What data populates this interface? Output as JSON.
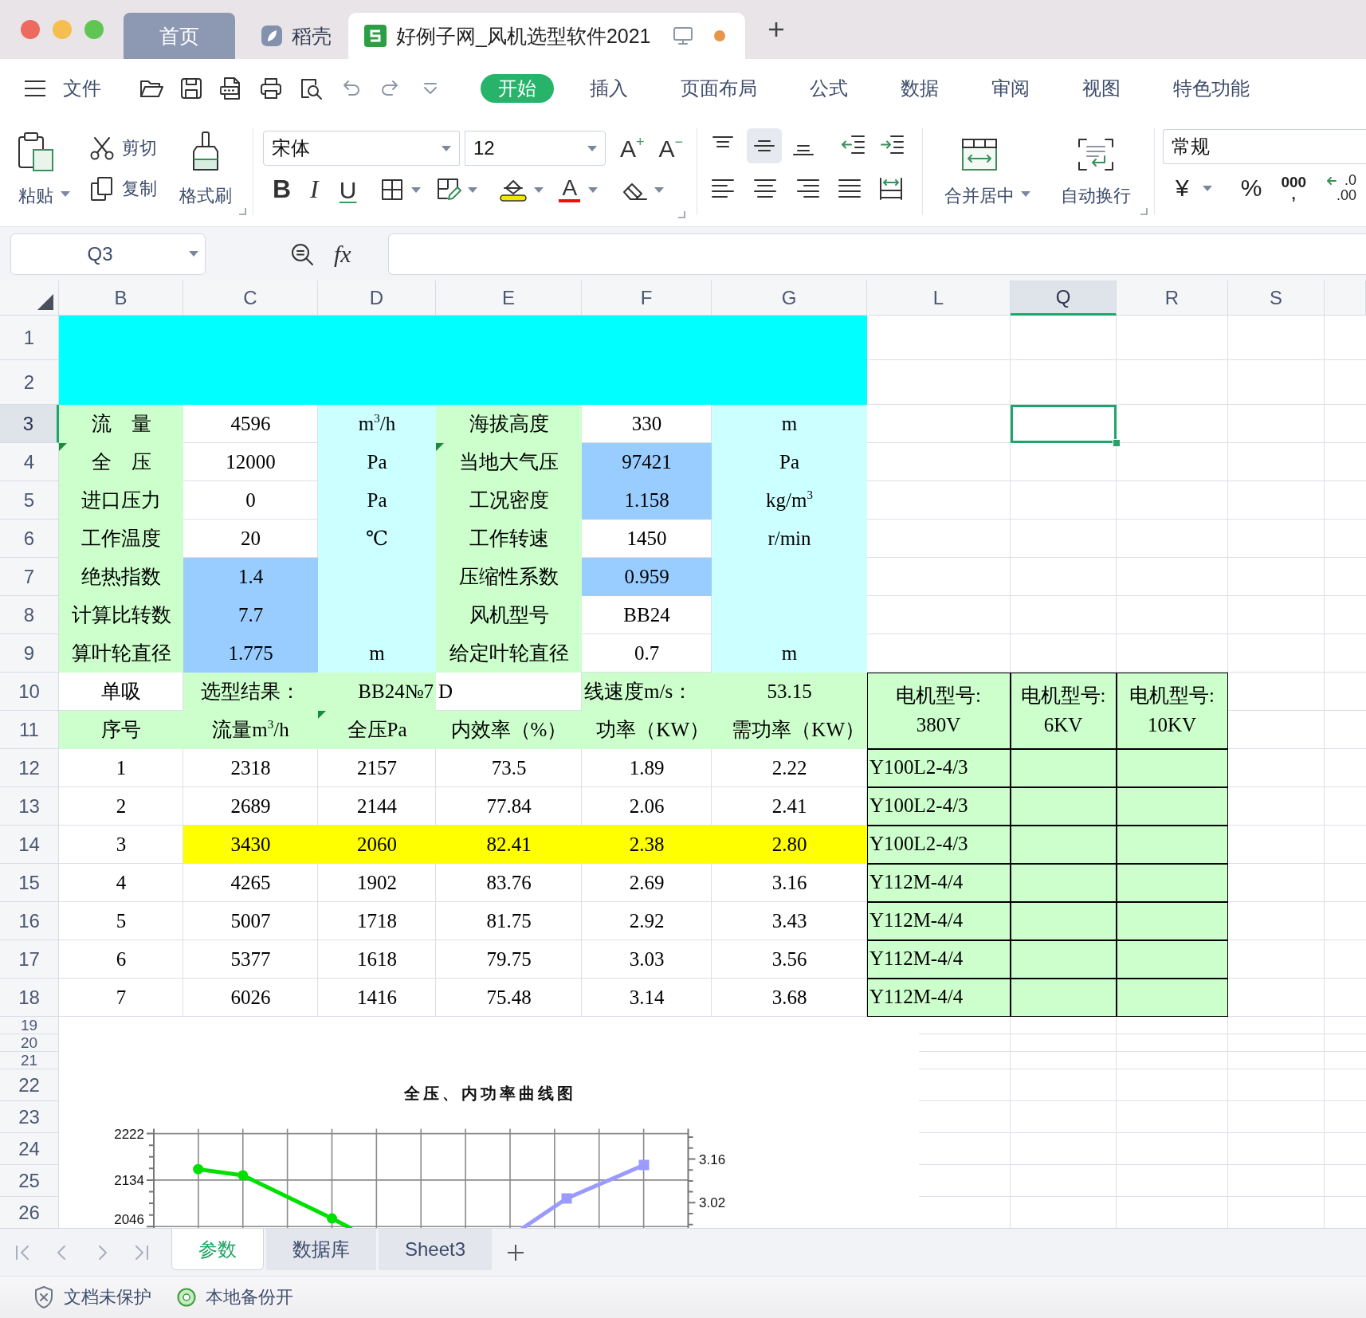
{
  "window": {
    "tabs": [
      {
        "kind": "home",
        "label": "首页",
        "selected": false,
        "unsaved": false
      },
      {
        "kind": "app",
        "label": "稻壳",
        "selected": false,
        "unsaved": false
      },
      {
        "kind": "document",
        "label": "好例子网_风机选型软件2021",
        "selected": true,
        "unsaved": true
      }
    ]
  },
  "menu": {
    "file": "文件",
    "tabs": [
      {
        "label": "开始",
        "selected": true
      },
      {
        "label": "插入",
        "selected": false
      },
      {
        "label": "页面布局",
        "selected": false
      },
      {
        "label": "公式",
        "selected": false
      },
      {
        "label": "数据",
        "selected": false
      },
      {
        "label": "审阅",
        "selected": false
      },
      {
        "label": "视图",
        "selected": false
      },
      {
        "label": "特色功能",
        "selected": false
      }
    ]
  },
  "ribbon": {
    "paste": "粘贴",
    "cut": "剪切",
    "copy": "复制",
    "format_painter": "格式刷",
    "font_name": "宋体",
    "font_size": "12",
    "grow_font": "A$^{+}$",
    "shrink_font": "A$^{−}$",
    "bold": "B",
    "italic": "I",
    "underline": "U",
    "font_color": "A",
    "vertical_align": [
      {
        "selected": false
      },
      {
        "selected": true
      },
      {
        "selected": false
      }
    ],
    "horizontal_align": [
      {
        "selected": false
      },
      {
        "selected": false
      },
      {
        "selected": false
      },
      {
        "selected": false
      },
      {
        "selected": false
      }
    ],
    "merge": "合并居中",
    "wrap_text": "自动换行",
    "number_format": "常规",
    "currency": "¥",
    "percent": "%",
    "thousands": "000\n,",
    "decimal_increase": ".0\n.00"
  },
  "formula_bar": {
    "name_box": "Q3",
    "function_label": "fx"
  },
  "sheet": {
    "columns": [
      {
        "label": "B",
        "selected": false
      },
      {
        "label": "C",
        "selected": false
      },
      {
        "label": "D",
        "selected": false
      },
      {
        "label": "E",
        "selected": false
      },
      {
        "label": "F",
        "selected": false
      },
      {
        "label": "G",
        "selected": false
      },
      {
        "label": "L",
        "selected": false
      },
      {
        "label": "Q",
        "selected": true
      },
      {
        "label": "R",
        "selected": false
      },
      {
        "label": "S",
        "selected": false
      }
    ],
    "rows": [
      {
        "label": "1",
        "selected": false,
        "cells": [
          {
            "kind": "fill",
            "color": "#00ffff",
            "flagged": false,
            "bordered": false
          },
          {
            "kind": "mergeleft"
          },
          {
            "kind": "mergeleft"
          },
          {
            "kind": "mergeleft"
          },
          {
            "kind": "mergeleft"
          },
          {
            "kind": "mergeleft"
          }
        ]
      },
      {
        "label": "2",
        "selected": false,
        "cells": [
          {
            "kind": "mergeup"
          },
          {
            "kind": "mergeup"
          },
          {
            "kind": "mergeup"
          },
          {
            "kind": "mergeup"
          },
          {
            "kind": "mergeup"
          },
          {
            "kind": "mergeup"
          }
        ]
      },
      {
        "label": "3",
        "selected": true,
        "cells": [
          {
            "kind": "text",
            "text": "流　量",
            "color": "#ccffcc",
            "flagged": false,
            "bordered": false
          },
          {
            "kind": "text",
            "text": "4596",
            "flagged": false,
            "bordered": false
          },
          {
            "kind": "text",
            "text": "m$^{3}$/h",
            "color": "#ccffff",
            "flagged": false,
            "bordered": false
          },
          {
            "kind": "text",
            "text": "海拔高度",
            "color": "#ccffcc",
            "flagged": false,
            "bordered": false
          },
          {
            "kind": "text",
            "text": "330",
            "flagged": false,
            "bordered": false
          },
          {
            "kind": "text",
            "text": "m",
            "color": "#ccffff",
            "flagged": false,
            "bordered": false
          }
        ]
      },
      {
        "label": "4",
        "selected": false,
        "cells": [
          {
            "kind": "text",
            "text": "全　压",
            "color": "#ccffcc",
            "flagged": true,
            "bordered": false
          },
          {
            "kind": "text",
            "text": "12000",
            "flagged": false,
            "bordered": false
          },
          {
            "kind": "text",
            "text": "Pa",
            "color": "#ccffff",
            "flagged": false,
            "bordered": false
          },
          {
            "kind": "text",
            "text": "当地大气压",
            "color": "#ccffcc",
            "flagged": true,
            "bordered": false
          },
          {
            "kind": "text",
            "text": "97421",
            "color": "#99ccff",
            "flagged": false,
            "bordered": false
          },
          {
            "kind": "text",
            "text": "Pa",
            "color": "#ccffff",
            "flagged": false,
            "bordered": false
          }
        ]
      },
      {
        "label": "5",
        "selected": false,
        "cells": [
          {
            "kind": "text",
            "text": "进口压力",
            "color": "#ccffcc",
            "flagged": false,
            "bordered": false
          },
          {
            "kind": "text",
            "text": "0",
            "flagged": false,
            "bordered": false
          },
          {
            "kind": "text",
            "text": "Pa",
            "color": "#ccffff",
            "flagged": false,
            "bordered": false
          },
          {
            "kind": "text",
            "text": "工况密度",
            "color": "#ccffcc",
            "flagged": false,
            "bordered": false
          },
          {
            "kind": "text",
            "text": "1.158",
            "color": "#99ccff",
            "flagged": false,
            "bordered": false
          },
          {
            "kind": "text",
            "text": "kg/m$^{3}$",
            "color": "#ccffff",
            "flagged": false,
            "bordered": false
          }
        ]
      },
      {
        "label": "6",
        "selected": false,
        "cells": [
          {
            "kind": "text",
            "text": "工作温度",
            "color": "#ccffcc",
            "flagged": false,
            "bordered": false
          },
          {
            "kind": "text",
            "text": "20",
            "flagged": false,
            "bordered": false
          },
          {
            "kind": "text",
            "text": "℃",
            "color": "#ccffff",
            "flagged": false,
            "bordered": false
          },
          {
            "kind": "text",
            "text": "工作转速",
            "color": "#ccffcc",
            "flagged": false,
            "bordered": false
          },
          {
            "kind": "text",
            "text": "1450",
            "flagged": false,
            "bordered": false
          },
          {
            "kind": "text",
            "text": "r/min",
            "color": "#ccffff",
            "flagged": false,
            "bordered": false
          }
        ]
      },
      {
        "label": "7",
        "selected": false,
        "cells": [
          {
            "kind": "text",
            "text": "绝热指数",
            "color": "#ccffcc",
            "flagged": false,
            "bordered": false
          },
          {
            "kind": "text",
            "text": "1.4",
            "color": "#99ccff",
            "flagged": false,
            "bordered": false
          },
          {
            "kind": "fill",
            "color": "#ccffff",
            "flagged": false,
            "bordered": false
          },
          {
            "kind": "text",
            "text": "压缩性系数",
            "color": "#ccffcc",
            "flagged": false,
            "bordered": false
          },
          {
            "kind": "text",
            "text": "0.959",
            "color": "#99ccff",
            "flagged": false,
            "bordered": false
          },
          {
            "kind": "fill",
            "color": "#ccffff",
            "flagged": false,
            "bordered": false
          }
        ]
      },
      {
        "label": "8",
        "selected": false,
        "cells": [
          {
            "kind": "text",
            "text": "计算比转数",
            "color": "#ccffcc",
            "flagged": false,
            "bordered": false
          },
          {
            "kind": "text",
            "text": "7.7",
            "color": "#99ccff",
            "flagged": false,
            "bordered": false
          },
          {
            "kind": "fill",
            "color": "#ccffff",
            "flagged": false,
            "bordered": false
          },
          {
            "kind": "text",
            "text": "风机型号",
            "color": "#ccffcc",
            "flagged": false,
            "bordered": false
          },
          {
            "kind": "text",
            "text": "BB24",
            "flagged": false,
            "bordered": false
          },
          {
            "kind": "fill",
            "color": "#ccffff",
            "flagged": false,
            "bordered": false
          }
        ]
      },
      {
        "label": "9",
        "selected": false,
        "cells": [
          {
            "kind": "text",
            "text": "算叶轮直径",
            "color": "#ccffcc",
            "flagged": false,
            "bordered": false
          },
          {
            "kind": "text",
            "text": "1.775",
            "color": "#99ccff",
            "flagged": false,
            "bordered": false
          },
          {
            "kind": "text",
            "text": "m",
            "color": "#ccffff",
            "flagged": false,
            "bordered": false
          },
          {
            "kind": "text",
            "text": "给定叶轮直径",
            "color": "#ccffcc",
            "flagged": false,
            "bordered": false
          },
          {
            "kind": "text",
            "text": "0.7",
            "flagged": false,
            "bordered": false
          },
          {
            "kind": "text",
            "text": "m",
            "color": "#ccffff",
            "flagged": false,
            "bordered": false
          }
        ]
      },
      {
        "label": "10",
        "selected": false,
        "cells": [
          {
            "kind": "text",
            "text": "单吸",
            "flagged": false,
            "bordered": false
          },
          {
            "kind": "text",
            "text": "选型结果：",
            "color": "#ccffcc",
            "flagged": false,
            "bordered": false
          },
          {
            "kind": "textright",
            "text": "BB24№7",
            "color": "#ccffcc",
            "flagged": false,
            "bordered": false
          },
          {
            "kind": "textleft",
            "text": "D",
            "flagged": false,
            "bordered": false
          },
          {
            "kind": "textleft",
            "text": "线速度m/s：",
            "color": "#ccffcc",
            "flagged": false,
            "bordered": false
          },
          {
            "kind": "text",
            "text": "53.15",
            "color": "#ccffcc",
            "flagged": false,
            "bordered": false
          },
          {
            "kind": "text",
            "text": "电机型号:\n380V",
            "color": "#ccffcc",
            "flagged": false,
            "bordered": true
          },
          {
            "kind": "text",
            "text": "电机型号:\n6KV",
            "color": "#ccffcc",
            "flagged": false,
            "bordered": true
          },
          {
            "kind": "text",
            "text": "电机型号:\n10KV",
            "color": "#ccffcc",
            "flagged": false,
            "bordered": true
          }
        ]
      },
      {
        "label": "11",
        "selected": false,
        "cells": [
          {
            "kind": "text",
            "text": "序号",
            "color": "#ccffcc",
            "flagged": false,
            "bordered": false
          },
          {
            "kind": "text",
            "text": "流量m$^{3}$/h",
            "color": "#ccffcc",
            "flagged": false,
            "bordered": false
          },
          {
            "kind": "text",
            "text": "全压Pa",
            "color": "#ccffcc",
            "flagged": true,
            "bordered": false
          },
          {
            "kind": "text",
            "text": "内效率（%）",
            "color": "#ccffcc",
            "flagged": false,
            "bordered": false
          },
          {
            "kind": "textright",
            "text": "功率（KW）",
            "color": "#ccffcc",
            "flagged": false,
            "bordered": false
          },
          {
            "kind": "textright",
            "text": "需功率（KW）",
            "color": "#ccffcc",
            "flagged": false,
            "bordered": false
          },
          {
            "kind": "mergeup"
          },
          {
            "kind": "mergeup"
          },
          {
            "kind": "mergeup"
          }
        ]
      },
      {
        "label": "12",
        "selected": false,
        "cells": [
          {
            "kind": "text",
            "text": "1",
            "flagged": false,
            "bordered": false
          },
          {
            "kind": "text",
            "text": "2318",
            "flagged": false,
            "bordered": false
          },
          {
            "kind": "text",
            "text": "2157",
            "flagged": false,
            "bordered": false
          },
          {
            "kind": "text",
            "text": "73.5",
            "flagged": false,
            "bordered": false
          },
          {
            "kind": "text",
            "text": "1.89",
            "flagged": false,
            "bordered": false
          },
          {
            "kind": "text",
            "text": "2.22",
            "flagged": false,
            "bordered": false
          },
          {
            "kind": "textleft",
            "text": "Y100L2-4/3",
            "color": "#ccffcc",
            "flagged": false,
            "bordered": true
          },
          {
            "kind": "fill",
            "color": "#ccffcc",
            "flagged": false,
            "bordered": true
          },
          {
            "kind": "fill",
            "color": "#ccffcc",
            "flagged": false,
            "bordered": true
          }
        ]
      },
      {
        "label": "13",
        "selected": false,
        "cells": [
          {
            "kind": "text",
            "text": "2",
            "flagged": false,
            "bordered": false
          },
          {
            "kind": "text",
            "text": "2689",
            "flagged": false,
            "bordered": false
          },
          {
            "kind": "text",
            "text": "2144",
            "flagged": false,
            "bordered": false
          },
          {
            "kind": "text",
            "text": "77.84",
            "flagged": false,
            "bordered": false
          },
          {
            "kind": "text",
            "text": "2.06",
            "flagged": false,
            "bordered": false
          },
          {
            "kind": "text",
            "text": "2.41",
            "flagged": false,
            "bordered": false
          },
          {
            "kind": "textleft",
            "text": "Y100L2-4/3",
            "color": "#ccffcc",
            "flagged": false,
            "bordered": true
          },
          {
            "kind": "fill",
            "color": "#ccffcc",
            "flagged": false,
            "bordered": true
          },
          {
            "kind": "fill",
            "color": "#ccffcc",
            "flagged": false,
            "bordered": true
          }
        ]
      },
      {
        "label": "14",
        "selected": false,
        "cells": [
          {
            "kind": "text",
            "text": "3",
            "flagged": false,
            "bordered": false
          },
          {
            "kind": "text",
            "text": "3430",
            "color": "#ffff00",
            "flagged": false,
            "bordered": false
          },
          {
            "kind": "text",
            "text": "2060",
            "color": "#ffff00",
            "flagged": false,
            "bordered": false
          },
          {
            "kind": "text",
            "text": "82.41",
            "color": "#ffff00",
            "flagged": false,
            "bordered": false
          },
          {
            "kind": "text",
            "text": "2.38",
            "color": "#ffff00",
            "flagged": false,
            "bordered": false
          },
          {
            "kind": "text",
            "text": "2.80",
            "color": "#ffff00",
            "flagged": false,
            "bordered": false
          },
          {
            "kind": "textleft",
            "text": "Y100L2-4/3",
            "color": "#ccffcc",
            "flagged": false,
            "bordered": true
          },
          {
            "kind": "fill",
            "color": "#ccffcc",
            "flagged": false,
            "bordered": true
          },
          {
            "kind": "fill",
            "color": "#ccffcc",
            "flagged": false,
            "bordered": true
          }
        ]
      },
      {
        "label": "15",
        "selected": false,
        "cells": [
          {
            "kind": "text",
            "text": "4",
            "flagged": false,
            "bordered": false
          },
          {
            "kind": "text",
            "text": "4265",
            "flagged": false,
            "bordered": false
          },
          {
            "kind": "text",
            "text": "1902",
            "flagged": false,
            "bordered": false
          },
          {
            "kind": "text",
            "text": "83.76",
            "flagged": false,
            "bordered": false
          },
          {
            "kind": "text",
            "text": "2.69",
            "flagged": false,
            "bordered": false
          },
          {
            "kind": "text",
            "text": "3.16",
            "flagged": false,
            "bordered": false
          },
          {
            "kind": "textleft",
            "text": "Y112M-4/4",
            "color": "#ccffcc",
            "flagged": false,
            "bordered": true
          },
          {
            "kind": "fill",
            "color": "#ccffcc",
            "flagged": false,
            "bordered": true
          },
          {
            "kind": "fill",
            "color": "#ccffcc",
            "flagged": false,
            "bordered": true
          }
        ]
      },
      {
        "label": "16",
        "selected": false,
        "cells": [
          {
            "kind": "text",
            "text": "5",
            "flagged": false,
            "bordered": false
          },
          {
            "kind": "text",
            "text": "5007",
            "flagged": false,
            "bordered": false
          },
          {
            "kind": "text",
            "text": "1718",
            "flagged": false,
            "bordered": false
          },
          {
            "kind": "text",
            "text": "81.75",
            "flagged": false,
            "bordered": false
          },
          {
            "kind": "text",
            "text": "2.92",
            "flagged": false,
            "bordered": false
          },
          {
            "kind": "text",
            "text": "3.43",
            "flagged": false,
            "bordered": false
          },
          {
            "kind": "textleft",
            "text": "Y112M-4/4",
            "color": "#ccffcc",
            "flagged": false,
            "bordered": true
          },
          {
            "kind": "fill",
            "color": "#ccffcc",
            "flagged": false,
            "bordered": true
          },
          {
            "kind": "fill",
            "color": "#ccffcc",
            "flagged": false,
            "bordered": true
          }
        ]
      },
      {
        "label": "17",
        "selected": false,
        "cells": [
          {
            "kind": "text",
            "text": "6",
            "flagged": false,
            "bordered": false
          },
          {
            "kind": "text",
            "text": "5377",
            "flagged": false,
            "bordered": false
          },
          {
            "kind": "text",
            "text": "1618",
            "flagged": false,
            "bordered": false
          },
          {
            "kind": "text",
            "text": "79.75",
            "flagged": false,
            "bordered": false
          },
          {
            "kind": "text",
            "text": "3.03",
            "flagged": false,
            "bordered": false
          },
          {
            "kind": "text",
            "text": "3.56",
            "flagged": false,
            "bordered": false
          },
          {
            "kind": "textleft",
            "text": "Y112M-4/4",
            "color": "#ccffcc",
            "flagged": false,
            "bordered": true
          },
          {
            "kind": "fill",
            "color": "#ccffcc",
            "flagged": false,
            "bordered": true
          },
          {
            "kind": "fill",
            "color": "#ccffcc",
            "flagged": false,
            "bordered": true
          }
        ]
      },
      {
        "label": "18",
        "selected": false,
        "cells": [
          {
            "kind": "text",
            "text": "7",
            "flagged": false,
            "bordered": false
          },
          {
            "kind": "text",
            "text": "6026",
            "flagged": false,
            "bordered": false
          },
          {
            "kind": "text",
            "text": "1416",
            "flagged": false,
            "bordered": false
          },
          {
            "kind": "text",
            "text": "75.48",
            "flagged": false,
            "bordered": false
          },
          {
            "kind": "text",
            "text": "3.14",
            "flagged": false,
            "bordered": false
          },
          {
            "kind": "text",
            "text": "3.68",
            "flagged": false,
            "bordered": false
          },
          {
            "kind": "textleft",
            "text": "Y112M-4/4",
            "color": "#ccffcc",
            "flagged": false,
            "bordered": true
          },
          {
            "kind": "fill",
            "color": "#ccffcc",
            "flagged": false,
            "bordered": true
          },
          {
            "kind": "fill",
            "color": "#ccffcc",
            "flagged": false,
            "bordered": true
          }
        ]
      },
      {
        "label": "19",
        "selected": false
      },
      {
        "label": "20",
        "selected": false
      },
      {
        "label": "21",
        "selected": false
      },
      {
        "label": "22",
        "selected": false
      },
      {
        "label": "23",
        "selected": false
      },
      {
        "label": "24",
        "selected": false
      },
      {
        "label": "25",
        "selected": false
      },
      {
        "label": "26",
        "selected": false
      }
    ],
    "chart": {
      "title": "全压、内功率曲线图",
      "left_axis_ticks": [
        "2222",
        "2134",
        "2046"
      ],
      "right_axis_ticks": [
        "3.16",
        "3.02"
      ]
    }
  },
  "sheet_tabs": [
    {
      "label": "参数",
      "selected": true
    },
    {
      "label": "数据库",
      "selected": false
    },
    {
      "label": "Sheet3",
      "selected": false
    }
  ],
  "status_bar": {
    "protection": "文档未保护",
    "backup": "本地备份开"
  }
}
